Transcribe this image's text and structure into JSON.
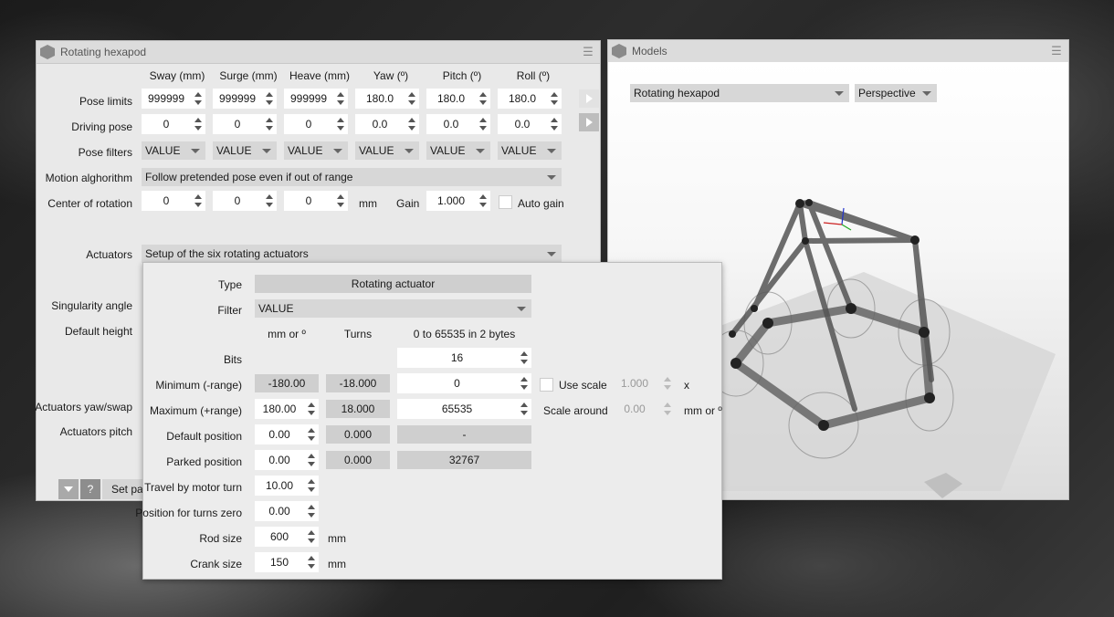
{
  "left_window": {
    "title": "Rotating hexapod",
    "col_headers": [
      "Sway (mm)",
      "Surge (mm)",
      "Heave (mm)",
      "Yaw (º)",
      "Pitch (º)",
      "Roll (º)"
    ],
    "pose_limits": {
      "label": "Pose limits",
      "values": [
        "999999",
        "999999",
        "999999",
        "180.0",
        "180.0",
        "180.0"
      ]
    },
    "driving_pose": {
      "label": "Driving pose",
      "values": [
        "0",
        "0",
        "0",
        "0.0",
        "0.0",
        "0.0"
      ]
    },
    "pose_filters": {
      "label": "Pose filters",
      "values": [
        "VALUE",
        "VALUE",
        "VALUE",
        "VALUE",
        "VALUE",
        "VALUE"
      ]
    },
    "motion": {
      "label": "Motion alghorithm",
      "value": "Follow pretended pose even if out of range"
    },
    "center": {
      "label": "Center of rotation",
      "values": [
        "0",
        "0",
        "0"
      ],
      "unit": "mm",
      "gain_label": "Gain",
      "gain": "1.000",
      "auto_gain": "Auto gain"
    },
    "actuators": {
      "label": "Actuators",
      "value": "Setup of the six rotating actuators"
    },
    "singularity_label": "Singularity angle",
    "default_height_label": "Default height",
    "yaw_swap_label": "Actuators yaw/swap",
    "pitch_label": "Actuators pitch",
    "help_label": "?",
    "set_label": "Set par"
  },
  "models_window": {
    "title": "Models",
    "model_select": "Rotating hexapod",
    "view_select": "Perspective"
  },
  "popup": {
    "type_label": "Type",
    "type_value": "Rotating actuator",
    "filter_label": "Filter",
    "filter_value": "VALUE",
    "col_mm": "mm or º",
    "col_turns": "Turns",
    "col_bytes": "0 to 65535 in 2 bytes",
    "bits_label": "Bits",
    "bits": "16",
    "min_label": "Minimum (-range)",
    "min_mm": "-180.00",
    "min_turns": "-18.000",
    "min_bytes": "0",
    "use_scale": "Use scale",
    "scale_value": "1.000",
    "scale_x": "x",
    "max_label": "Maximum (+range)",
    "max_mm": "180.00",
    "max_turns": "18.000",
    "max_bytes": "65535",
    "scale_around": "Scale around",
    "scale_around_value": "0.00",
    "scale_unit": "mm or º",
    "default_label": "Default position",
    "default_mm": "0.00",
    "default_turns": "0.000",
    "default_bytes": "-",
    "parked_label": "Parked position",
    "parked_mm": "0.00",
    "parked_turns": "0.000",
    "parked_bytes": "32767",
    "travel_label": "Travel by motor turn",
    "travel": "10.00",
    "zero_label": "Position for turns zero",
    "zero": "0.00",
    "rod_label": "Rod size",
    "rod": "600",
    "rod_unit": "mm",
    "crank_label": "Crank size",
    "crank": "150",
    "crank_unit": "mm"
  }
}
